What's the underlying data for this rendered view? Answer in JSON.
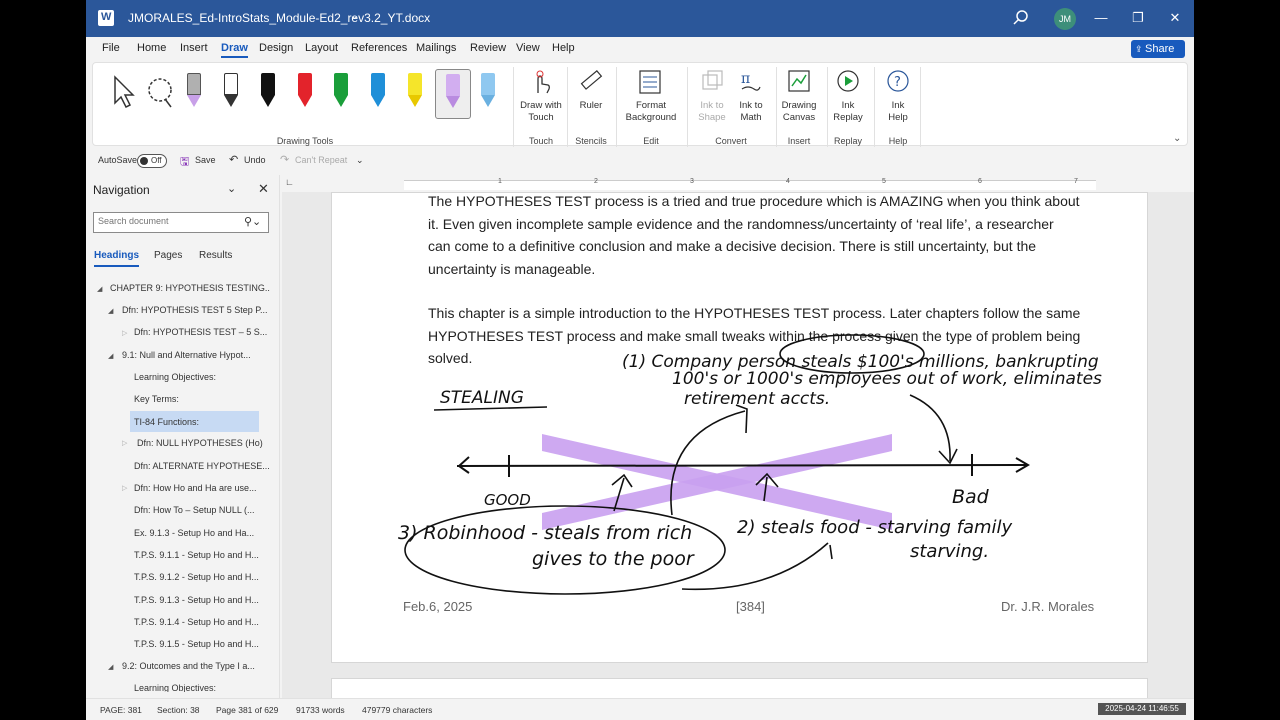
{
  "titlebar": {
    "doc_title": "JMORALES_Ed-IntroStats_Module-Ed2_rev3.2_YT.docx",
    "avatar_initials": "JM",
    "accent_color": "#2b579a"
  },
  "menu": {
    "tabs": [
      "File",
      "Home",
      "Insert",
      "Draw",
      "Design",
      "Layout",
      "References",
      "Mailings",
      "Review",
      "View",
      "Help"
    ],
    "active_tab": "Draw",
    "share_label": "Share"
  },
  "ribbon": {
    "drawing_tools_label": "Drawing Tools",
    "pens": [
      {
        "name": "select-tool"
      },
      {
        "name": "lasso-tool"
      },
      {
        "name": "eraser",
        "color": "#b0b0b0"
      },
      {
        "name": "pen-outline",
        "color": "#ffffff"
      },
      {
        "name": "pen-black",
        "color": "#111111"
      },
      {
        "name": "pen-red",
        "color": "#e3232b"
      },
      {
        "name": "pen-green",
        "color": "#1a9e3a"
      },
      {
        "name": "pen-blue",
        "color": "#1f8fd8"
      },
      {
        "name": "highlighter-yellow",
        "color": "#f5e52a"
      },
      {
        "name": "highlighter-purple",
        "color": "#d2aef0"
      },
      {
        "name": "pen-lightblue",
        "color": "#8fc8f0"
      }
    ],
    "buttons": {
      "draw_with_touch": "Draw with Touch",
      "ruler": "Ruler",
      "format_background": "Format Background",
      "ink_to_shape": "Ink to Shape",
      "ink_to_math": "Ink to Math",
      "drawing_canvas": "Drawing Canvas",
      "ink_replay": "Ink Replay",
      "ink_help": "Ink Help"
    },
    "groups": {
      "touch": "Touch",
      "stencils": "Stencils",
      "edit": "Edit",
      "convert": "Convert",
      "insert": "Insert",
      "replay": "Replay",
      "help": "Help"
    }
  },
  "qat": {
    "autosave": "AutoSave",
    "toggle_state": "Off",
    "save": "Save",
    "undo": "Undo",
    "cant_repeat": "Can't Repeat"
  },
  "navigation": {
    "title": "Navigation",
    "search_placeholder": "Search document",
    "tabs": [
      "Headings",
      "Pages",
      "Results"
    ],
    "items": [
      "CHAPTER 9: HYPOTHESIS TESTING...",
      "Dfn: HYPOTHESIS TEST 5 Step P...",
      "Dfn: HYPOTHESIS TEST – 5 S...",
      "9.1: Null and Alternative Hypot...",
      "Learning Objectives:",
      "Key Terms:",
      "TI-84 Functions:",
      "Dfn: NULL HYPOTHESES (Ho)",
      "Dfn: ALTERNATE HYPOTHESE...",
      "Dfn: How Ho and Ha are use...",
      "Dfn: How To – Setup NULL (...",
      "Ex. 9.1.3 - Setup Ho and Ha...",
      "T.P.S. 9.1.1 - Setup Ho and H...",
      "T.P.S. 9.1.2 - Setup Ho and H...",
      "T.P.S. 9.1.3 - Setup Ho and H...",
      "T.P.S. 9.1.4 - Setup Ho and H...",
      "T.P.S. 9.1.5 - Setup Ho and H...",
      "9.2: Outcomes and the Type I a...",
      "Learning Objectives:"
    ]
  },
  "ruler": {
    "numbers": [
      "1",
      "2",
      "3",
      "4",
      "5",
      "6",
      "7"
    ]
  },
  "document": {
    "para1": [
      "The HYPOTHESES TEST process is a tried and true procedure which is AMAZING when you think about",
      "it. Even given incomplete sample evidence and the randomness/uncertainty of ‘real life’, a researcher",
      "can come to a definitive conclusion and make a decisive decision. There is still uncertainty, but the",
      "uncertainty is manageable."
    ],
    "para2": [
      "This chapter is a simple introduction to the HYPOTHESES TEST process. Later chapters follow the same",
      "HYPOTHESES TEST process and make small tweaks within the process given the type of problem being",
      "solved."
    ],
    "footer_left": "Feb.6, 2025",
    "footer_center": "[384]",
    "footer_right": "Dr. J.R. Morales",
    "ink": {
      "heading": "STEALING",
      "line1": "(1) Company person steals $100's millions, bankrupting",
      "line2": "100's or 1000's employees out of work, eliminates",
      "line3": "retirement accts.",
      "good": "GOOD",
      "bad": "Bad",
      "item3a": "3) Robinhood - steals from rich",
      "item3b": "gives to the poor",
      "item2a": "2) steals food - starving family",
      "item2b": "starving.",
      "highlight_color": "#c9a0f0"
    }
  },
  "status": {
    "page": "PAGE: 381",
    "section": "Section: 38",
    "page_of": "Page 381 of 629",
    "words": "91733 words",
    "chars": "479779 characters",
    "clock": "2025-04-24 11:46:55"
  }
}
